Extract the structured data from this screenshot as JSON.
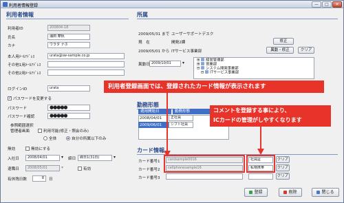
{
  "window": {
    "title": "利用者情報登録",
    "min": "—",
    "max": "□",
    "close": "✕"
  },
  "user": {
    "section_title": "利用者情報",
    "id_label": "利用者ID",
    "id_value": "200804-18",
    "name_label": "氏名",
    "name_value": "浦田 摩帆",
    "kana_label": "カナ",
    "kana_value": "ウラタ ナホ",
    "mail_label": "本人用ﾒｰﾙｱﾄﾞﾚｽ",
    "mail_value": "urata@sw-sample.co.jp",
    "mail2_label": "その他1用ﾒｰﾙｱﾄﾞﾚｽ",
    "mail3_label": "その他2用ﾒｰﾙｱﾄﾞﾚｽ",
    "login_label": "ログインID",
    "login_value": "urata",
    "pw_change_label": "パスワードを変更する",
    "pw_label": "パスワード",
    "pw_value": "●●●●●",
    "pw_confirm_label": "パスワード確認",
    "pw_confirm_value": "●●●●●",
    "ref_label": "参照範囲選択",
    "admin_label": "管理者画面",
    "admin_check_label": "利用可能(修正・照会のみ)",
    "radio_all": "全体",
    "radio_self": "自分の所属以下のみ",
    "invalid_label": "無効",
    "invalid_check_label": "無効にする",
    "join_label": "入社日",
    "join_value": "2008/04/01",
    "closing_label": "締日",
    "closing_value": "締日1(31日)",
    "retire_label": "退職日",
    "retire_value": "2008/05/01",
    "valid_label": "有効",
    "paidleave_label": "有休残日数",
    "paidleave_value": "8",
    "paidleave_unit": "日"
  },
  "affiliation": {
    "section_title": "所属",
    "rows": [
      {
        "date": "2009/05/31 まで",
        "name": "ユーザーサポートデスク"
      },
      {
        "date": "現　在",
        "name": "開発2課"
      },
      {
        "date": "2009/05/01 から",
        "name": "ITサービス事業部"
      }
    ],
    "edit_btn": "修正",
    "transfer_btn": "異動・修正",
    "clear_btn": "クリア",
    "transfer_date_label": "異動日",
    "transfer_date_value": "2009/10/01",
    "tree": [
      "経営管理部",
      "営業部",
      "システム開発事業部",
      "ITサービス事業部",
      "ユーザーサポートデスク",
      "開発1課",
      "開発2課"
    ]
  },
  "employment": {
    "section_title": "勤務形態",
    "columns": [
      "適用開始日",
      "勤務形態"
    ],
    "rows": [
      {
        "date": "2008/04/01",
        "type": "正社員"
      },
      {
        "date": "2009/06/01",
        "type": "シフト社員"
      }
    ]
  },
  "card": {
    "section_title": "カード情報",
    "rows": [
      {
        "label": "カード番号1",
        "value": "cardsample0016",
        "comment": "社員証",
        "clear": "クリア"
      },
      {
        "label": "カード番号2",
        "value": "cellphonesample16",
        "comment": "私物携帯",
        "clear": "クリア"
      },
      {
        "label": "カード番号3",
        "value": "",
        "comment": "",
        "clear": "クリア"
      }
    ]
  },
  "callouts": {
    "main": "利用者登録画面では、登録されたカード情報が表示されます",
    "comment_line1": "コメントを登録する事により、",
    "comment_line2": "ICカードの管理がしやすくなります"
  },
  "footer": {
    "register": "登録",
    "delete": "削除",
    "close": "閉じる"
  },
  "colors": {
    "accent": "#3f6fc7",
    "callout": "#e8332b",
    "section": "#2a4a8a"
  }
}
